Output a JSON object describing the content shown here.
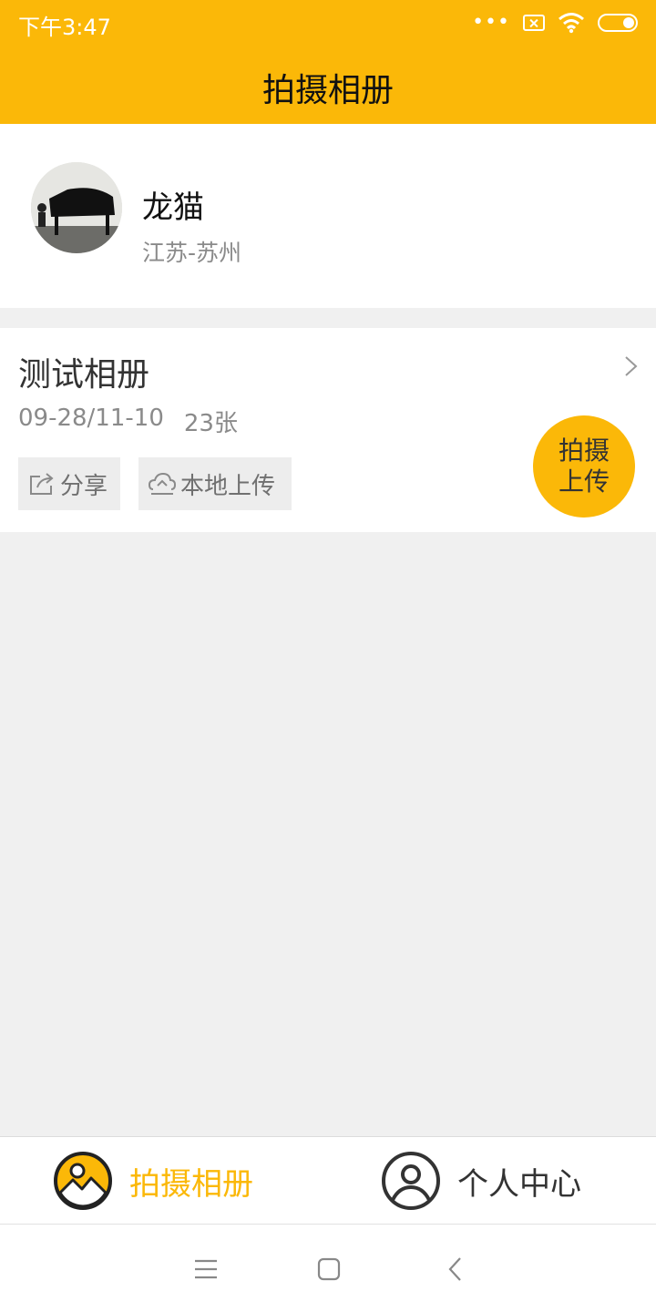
{
  "status_bar": {
    "time": "下午3:47",
    "dots": "•••",
    "icons": [
      "more-dots-icon",
      "sim-off-icon",
      "wifi-icon",
      "battery-icon"
    ]
  },
  "header": {
    "title": "拍摄相册"
  },
  "profile": {
    "name": "龙猫",
    "location": "江苏-苏州",
    "avatar_icon": "avatar-piano-photo"
  },
  "album": {
    "title": "测试相册",
    "date_range": "09-28/11-10",
    "count": "23张",
    "share_label": "分享",
    "upload_label": "本地上传",
    "share_icon": "share-icon",
    "upload_icon": "cloud-upload-icon",
    "arrow_icon": "chevron-right-icon"
  },
  "fab": {
    "line1": "拍摄",
    "line2": "上传"
  },
  "tabbar": {
    "items": [
      {
        "label": "拍摄相册",
        "icon": "album-icon",
        "active": true
      },
      {
        "label": "个人中心",
        "icon": "user-icon",
        "active": false
      }
    ]
  },
  "system_nav": {
    "icons": [
      "menu-icon",
      "home-icon",
      "back-icon"
    ]
  },
  "colors": {
    "accent": "#fbb808",
    "background": "#f0f0f0",
    "card": "#ffffff",
    "text_primary": "#333333",
    "text_secondary": "#8a8a8a"
  }
}
